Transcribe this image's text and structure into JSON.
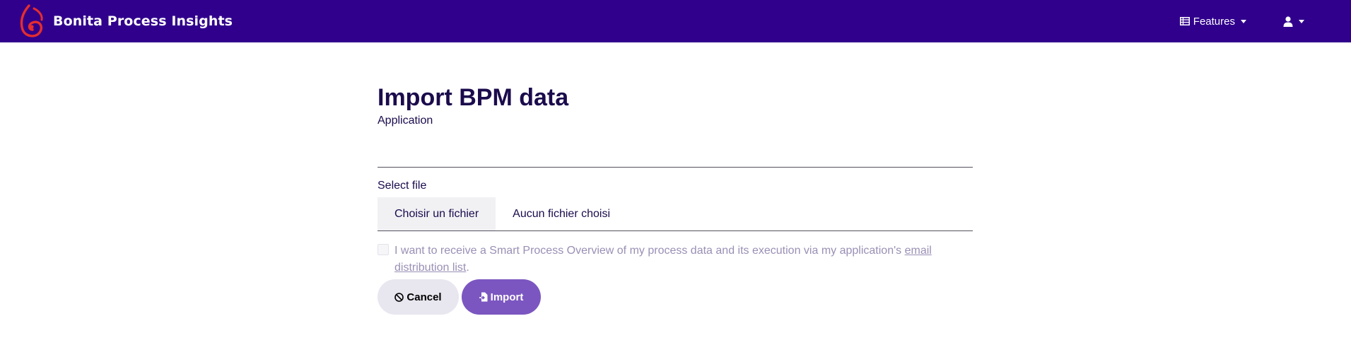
{
  "app": {
    "brand_name": "Bonita Process Insights",
    "colors": {
      "navbar": "#30008c",
      "logo": "#e52d2d",
      "primary_button": "#7b56c0",
      "secondary_button": "#e8e6ef",
      "text": "#1b0b4c",
      "muted_text": "#9a8fb5"
    }
  },
  "nav": {
    "features": {
      "label": "Features",
      "icon": "table-icon"
    },
    "user": {
      "icon": "user-icon"
    }
  },
  "form": {
    "title": "Import BPM data",
    "application": {
      "label": "Application",
      "value": ""
    },
    "file": {
      "label": "Select file",
      "button_label": "Choisir un fichier",
      "status": "Aucun fichier choisi"
    },
    "consent": {
      "checked": false,
      "text": "I want to receive a Smart Process Overview of my process data and its execution via my application's ",
      "link_text": "email distribution list",
      "suffix": "."
    },
    "actions": {
      "cancel_label": "Cancel",
      "import_label": "Import"
    }
  }
}
